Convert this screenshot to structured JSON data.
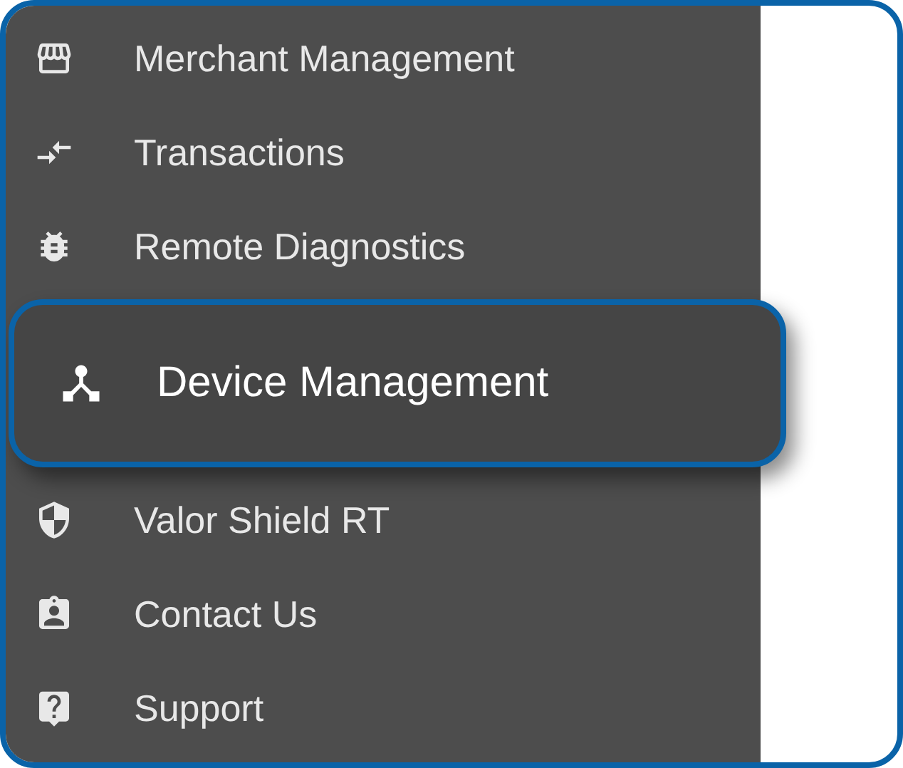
{
  "sidebar": {
    "items": [
      {
        "label": "Merchant Management",
        "selected": false
      },
      {
        "label": "Transactions",
        "selected": false
      },
      {
        "label": "Remote Diagnostics",
        "selected": false
      },
      {
        "label": "Device Management",
        "selected": true
      },
      {
        "label": "Valor Shield RT",
        "selected": false
      },
      {
        "label": "Contact Us",
        "selected": false
      },
      {
        "label": "Support",
        "selected": false
      }
    ]
  }
}
